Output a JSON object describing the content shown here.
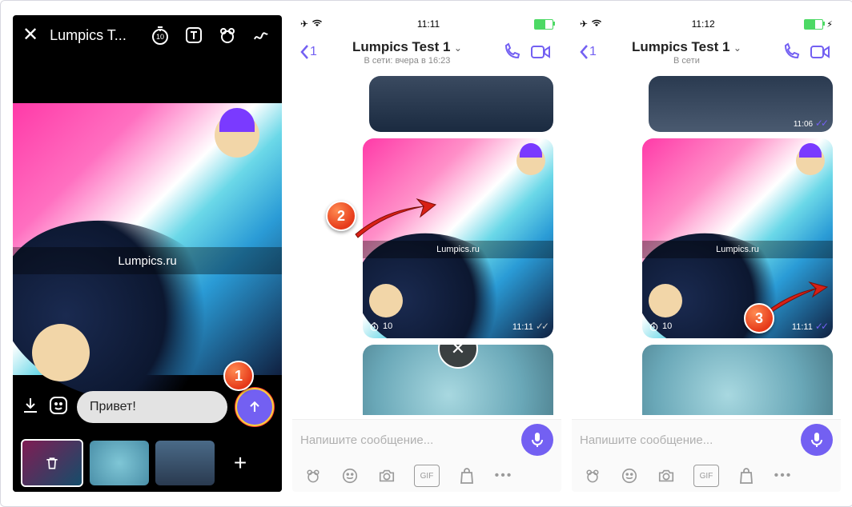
{
  "markers": {
    "m1": "1",
    "m2": "2",
    "m3": "3"
  },
  "editor": {
    "title": "Lumpics T...",
    "timer_value": "10",
    "caption": "Lumpics.ru",
    "message_text": "Привет!",
    "icons": {
      "close": "close-icon",
      "timer": "timer-icon",
      "text": "text-tool-icon",
      "sticker_bear": "bear-icon",
      "doodle": "doodle-icon",
      "download": "download-icon",
      "emoji": "emoji-icon",
      "send": "send-icon",
      "trash": "trash-icon",
      "add": "+"
    }
  },
  "chat2": {
    "status_time": "11:11",
    "back_count": "1",
    "contact_name": "Lumpics Test 1",
    "presence": "В сети: вчера в 16:23",
    "watermark": "Lumpics.ru",
    "msg_timer": "10",
    "msg_time": "11:11",
    "input_placeholder": "Напишите сообщение...",
    "top_bubble_time": ""
  },
  "chat3": {
    "status_time": "11:12",
    "back_count": "1",
    "contact_name": "Lumpics Test 1",
    "presence": "В сети",
    "watermark": "Lumpics.ru",
    "msg_timer": "10",
    "msg_time": "11:11",
    "top_bubble_time": "11:06",
    "input_placeholder": "Напишите сообщение..."
  },
  "toolbar_icons": [
    "bear",
    "smile",
    "camera",
    "gif",
    "shop",
    "more"
  ]
}
